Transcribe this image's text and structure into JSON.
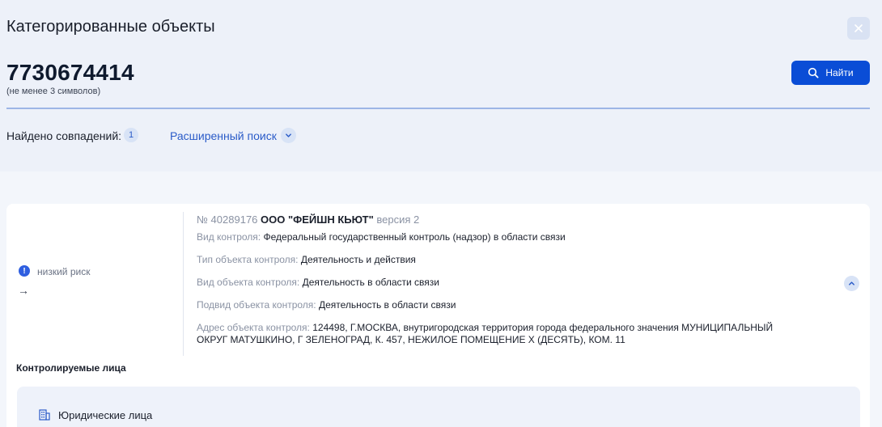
{
  "header": {
    "title": "Категорированные объекты",
    "search_value": "7730674414",
    "search_hint": "(не менее 3 символов)",
    "find_label": "Найти",
    "matches_label": "Найдено совпадений:",
    "matches_count": "1",
    "advanced_search_label": "Расширенный поиск"
  },
  "result": {
    "risk_label": "низкий риск",
    "arrow": "→",
    "number": "№ 40289176",
    "name": "ООО \"ФЕЙШН КЬЮТ\"",
    "version": "версия 2",
    "fields": [
      {
        "label": "Вид контроля:",
        "value": "Федеральный государственный контроль (надзор) в области связи"
      },
      {
        "label": "Тип объекта контроля:",
        "value": "Деятельность и действия"
      },
      {
        "label": "Вид объекта контроля:",
        "value": "Деятельность в области связи"
      },
      {
        "label": "Подвид объекта контроля:",
        "value": "Деятельность в области связи"
      },
      {
        "label": "Адрес объекта контроля:",
        "value": "124498, Г.МОСКВА, внутригородская территория города федерального значения МУНИЦИПАЛЬНЫЙ",
        "value2": "ОКРУГ МАТУШКИНО, Г ЗЕЛЕНОГРАД, К. 457, НЕЖИЛОЕ ПОМЕЩЕНИЕ X (ДЕСЯТЬ), КОМ. 11"
      }
    ],
    "controlled_title": "Контролируемые лица",
    "legal_entities_label": "Юридические лица"
  },
  "icons": {
    "close": "close-icon",
    "search": "search-icon",
    "chevron_down": "chevron-down-icon",
    "chevron_up": "chevron-up-icon",
    "info": "info-icon",
    "building": "building-icon"
  },
  "colors": {
    "accent": "#0a4dd6",
    "link": "#2a5bc8",
    "risk": "#2f5fe0"
  }
}
